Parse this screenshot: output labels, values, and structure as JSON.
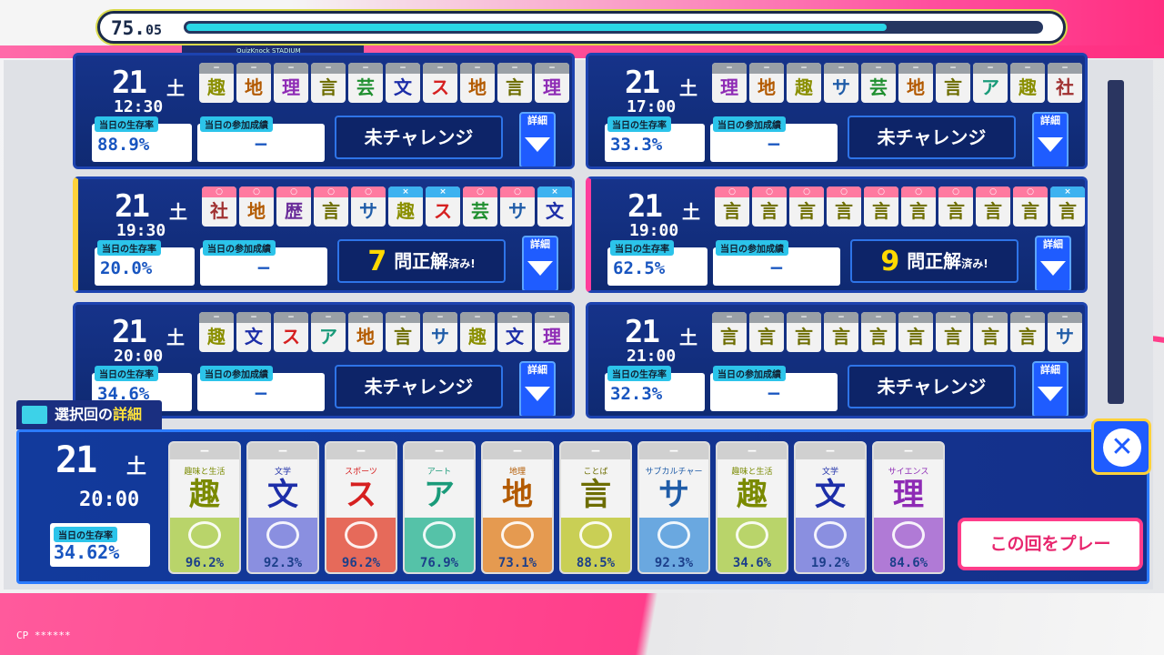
{
  "timer": {
    "main": "75.",
    "sub": "05",
    "progress": 0.82
  },
  "tag": "QuizKnock STADIUM",
  "colors": {
    "趣": "#8a8f00",
    "地": "#b35a00",
    "理": "#8e2bb5",
    "言": "#6d6d00",
    "芸": "#1f8f2f",
    "文": "#1d2ea8",
    "ス": "#d62020",
    "社": "#a03030",
    "サ": "#1f5ca8",
    "ア": "#1a9b7a",
    "歴": "#6a2c9a"
  },
  "headcolors": {
    "o": "#ff7aa0",
    "x": "#3db2f0",
    "-": "#9aa0a6"
  },
  "cards": [
    {
      "day": "21",
      "wd": "土",
      "time": "12:30",
      "survival": "88.9%",
      "participation": "−",
      "result_type": "none",
      "result_label": "未チャレンジ",
      "tiles": [
        "趣",
        "地",
        "理",
        "言",
        "芸",
        "文",
        "ス",
        "地",
        "言",
        "理"
      ],
      "heads": [
        "-",
        "-",
        "-",
        "-",
        "-",
        "-",
        "-",
        "-",
        "-",
        "-"
      ]
    },
    {
      "day": "21",
      "wd": "土",
      "time": "17:00",
      "survival": "33.3%",
      "participation": "−",
      "result_type": "none",
      "result_label": "未チャレンジ",
      "tiles": [
        "理",
        "地",
        "趣",
        "サ",
        "芸",
        "地",
        "言",
        "ア",
        "趣",
        "社"
      ],
      "heads": [
        "-",
        "-",
        "-",
        "-",
        "-",
        "-",
        "-",
        "-",
        "-",
        "-"
      ]
    },
    {
      "day": "21",
      "wd": "土",
      "time": "19:30",
      "survival": "20.0%",
      "participation": "−",
      "result_type": "done",
      "result_num": "7",
      "result_label": "問正解",
      "result_small": "済み!",
      "tiles": [
        "社",
        "地",
        "歴",
        "言",
        "サ",
        "趣",
        "ス",
        "芸",
        "サ",
        "文"
      ],
      "heads": [
        "o",
        "o",
        "o",
        "o",
        "o",
        "x",
        "x",
        "o",
        "o",
        "x"
      ]
    },
    {
      "day": "21",
      "wd": "土",
      "time": "19:00",
      "survival": "62.5%",
      "participation": "−",
      "result_type": "done",
      "result_num": "9",
      "result_label": "問正解",
      "result_small": "済み!",
      "tiles": [
        "言",
        "言",
        "言",
        "言",
        "言",
        "言",
        "言",
        "言",
        "言",
        "言"
      ],
      "heads": [
        "o",
        "o",
        "o",
        "o",
        "o",
        "o",
        "o",
        "o",
        "o",
        "x"
      ]
    },
    {
      "day": "21",
      "wd": "土",
      "time": "20:00",
      "survival": "34.6%",
      "participation": "−",
      "result_type": "none",
      "result_label": "未チャレンジ",
      "tiles": [
        "趣",
        "文",
        "ス",
        "ア",
        "地",
        "言",
        "サ",
        "趣",
        "文",
        "理"
      ],
      "heads": [
        "-",
        "-",
        "-",
        "-",
        "-",
        "-",
        "-",
        "-",
        "-",
        "-"
      ]
    },
    {
      "day": "21",
      "wd": "土",
      "time": "21:00",
      "survival": "32.3%",
      "participation": "−",
      "result_type": "none",
      "result_label": "未チャレンジ",
      "tiles": [
        "言",
        "言",
        "言",
        "言",
        "言",
        "言",
        "言",
        "言",
        "言",
        "サ"
      ],
      "heads": [
        "-",
        "-",
        "-",
        "-",
        "-",
        "-",
        "-",
        "-",
        "-",
        "-"
      ]
    }
  ],
  "labels": {
    "survival": "当日の生存率",
    "participation": "当日の参加成績",
    "detail_btn": "詳細"
  },
  "detail": {
    "header_a": "選択回の",
    "header_b": "詳細",
    "day": "21",
    "wd": "土",
    "time": "20:00",
    "survival": "34.62%",
    "play": "この回をプレー",
    "tiles": [
      {
        "genre": "趣味と生活",
        "k": "趣",
        "pct": "96.2%",
        "bg": "#b9d46a",
        "fg": "#7a8a00"
      },
      {
        "genre": "文学",
        "k": "文",
        "pct": "92.3%",
        "bg": "#8a8fe0",
        "fg": "#1d2ea8"
      },
      {
        "genre": "スポーツ",
        "k": "ス",
        "pct": "96.2%",
        "bg": "#e66a5a",
        "fg": "#d62020"
      },
      {
        "genre": "アート",
        "k": "ア",
        "pct": "76.9%",
        "bg": "#55c2a8",
        "fg": "#1a9b7a"
      },
      {
        "genre": "地理",
        "k": "地",
        "pct": "73.1%",
        "bg": "#e59a50",
        "fg": "#b35a00"
      },
      {
        "genre": "ことば",
        "k": "言",
        "pct": "88.5%",
        "bg": "#c9cf55",
        "fg": "#6d6d00"
      },
      {
        "genre": "サブカルチャー",
        "k": "サ",
        "pct": "92.3%",
        "bg": "#6aa8e0",
        "fg": "#1f5ca8"
      },
      {
        "genre": "趣味と生活",
        "k": "趣",
        "pct": "34.6%",
        "bg": "#b9d46a",
        "fg": "#7a8a00"
      },
      {
        "genre": "文学",
        "k": "文",
        "pct": "19.2%",
        "bg": "#8a8fe0",
        "fg": "#1d2ea8"
      },
      {
        "genre": "サイエンス",
        "k": "理",
        "pct": "84.6%",
        "bg": "#b07ad6",
        "fg": "#8e2bb5"
      }
    ]
  },
  "cp": "CP ******"
}
